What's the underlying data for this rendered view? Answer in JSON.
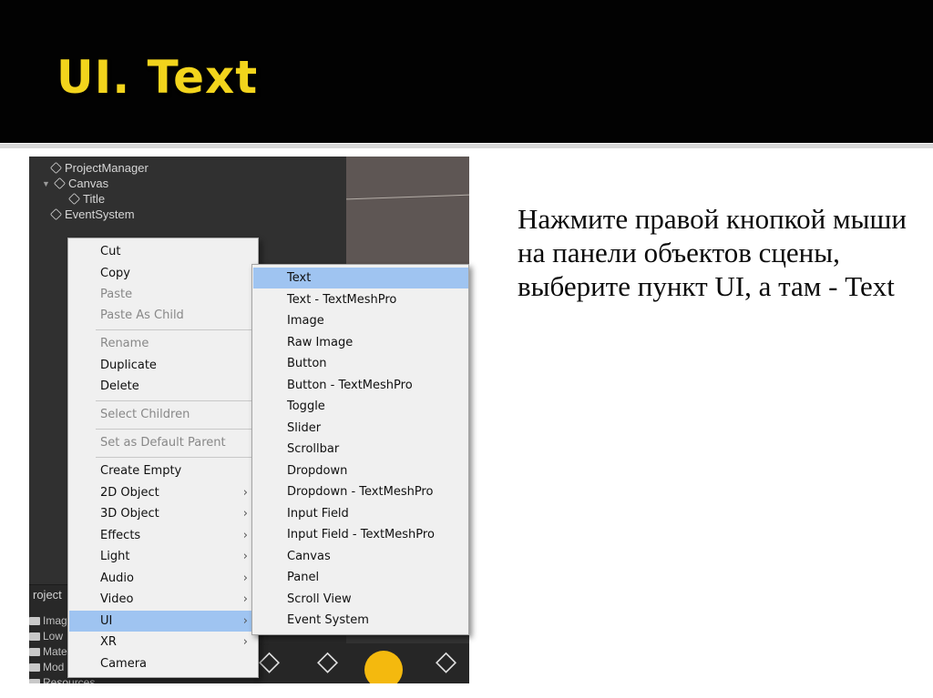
{
  "slide": {
    "title": "UI. Text",
    "instruction": "Нажмите правой кнопкой мыши на панели объектов сцены, выберите пункт UI, а там - Text"
  },
  "hierarchy": {
    "items": [
      {
        "label": "ProjectManager",
        "icon": "cube-icon"
      },
      {
        "label": "Canvas",
        "icon": "cube-icon",
        "expanded": true
      },
      {
        "label": "Title",
        "icon": "cube-icon"
      },
      {
        "label": "EventSystem",
        "icon": "cube-icon"
      }
    ]
  },
  "project_panel": {
    "tab": "roject",
    "folders": [
      "Imag",
      "Low",
      "Mate",
      "Mod",
      "Resources"
    ]
  },
  "context_menu": {
    "items": [
      {
        "label": "Cut",
        "disabled": false
      },
      {
        "label": "Copy",
        "disabled": false
      },
      {
        "label": "Paste",
        "disabled": true
      },
      {
        "label": "Paste As Child",
        "disabled": true
      },
      {
        "label": "Rename",
        "disabled": true
      },
      {
        "label": "Duplicate",
        "disabled": false
      },
      {
        "label": "Delete",
        "disabled": false
      },
      {
        "label": "Select Children",
        "disabled": true
      },
      {
        "label": "Set as Default Parent",
        "disabled": true
      },
      {
        "label": "Create Empty",
        "disabled": false
      },
      {
        "label": "2D Object",
        "submenu": true
      },
      {
        "label": "3D Object",
        "submenu": true
      },
      {
        "label": "Effects",
        "submenu": true
      },
      {
        "label": "Light",
        "submenu": true
      },
      {
        "label": "Audio",
        "submenu": true
      },
      {
        "label": "Video",
        "submenu": true
      },
      {
        "label": "UI",
        "submenu": true,
        "active": true
      },
      {
        "label": "XR",
        "submenu": true
      },
      {
        "label": "Camera",
        "disabled": false
      }
    ],
    "arrow_glyph": "›"
  },
  "ui_submenu": {
    "items": [
      {
        "label": "Text",
        "active": true
      },
      {
        "label": "Text - TextMeshPro"
      },
      {
        "label": "Image"
      },
      {
        "label": "Raw Image"
      },
      {
        "label": "Button"
      },
      {
        "label": "Button - TextMeshPro"
      },
      {
        "label": "Toggle"
      },
      {
        "label": "Slider"
      },
      {
        "label": "Scrollbar"
      },
      {
        "label": "Dropdown"
      },
      {
        "label": "Dropdown - TextMeshPro"
      },
      {
        "label": "Input Field"
      },
      {
        "label": "Input Field - TextMeshPro"
      },
      {
        "label": "Canvas"
      },
      {
        "label": "Panel"
      },
      {
        "label": "Scroll View"
      },
      {
        "label": "Event System"
      }
    ]
  },
  "colors": {
    "title": "#f2d41c",
    "highlight": "#9fc4f1",
    "editor_bg": "#303030"
  }
}
